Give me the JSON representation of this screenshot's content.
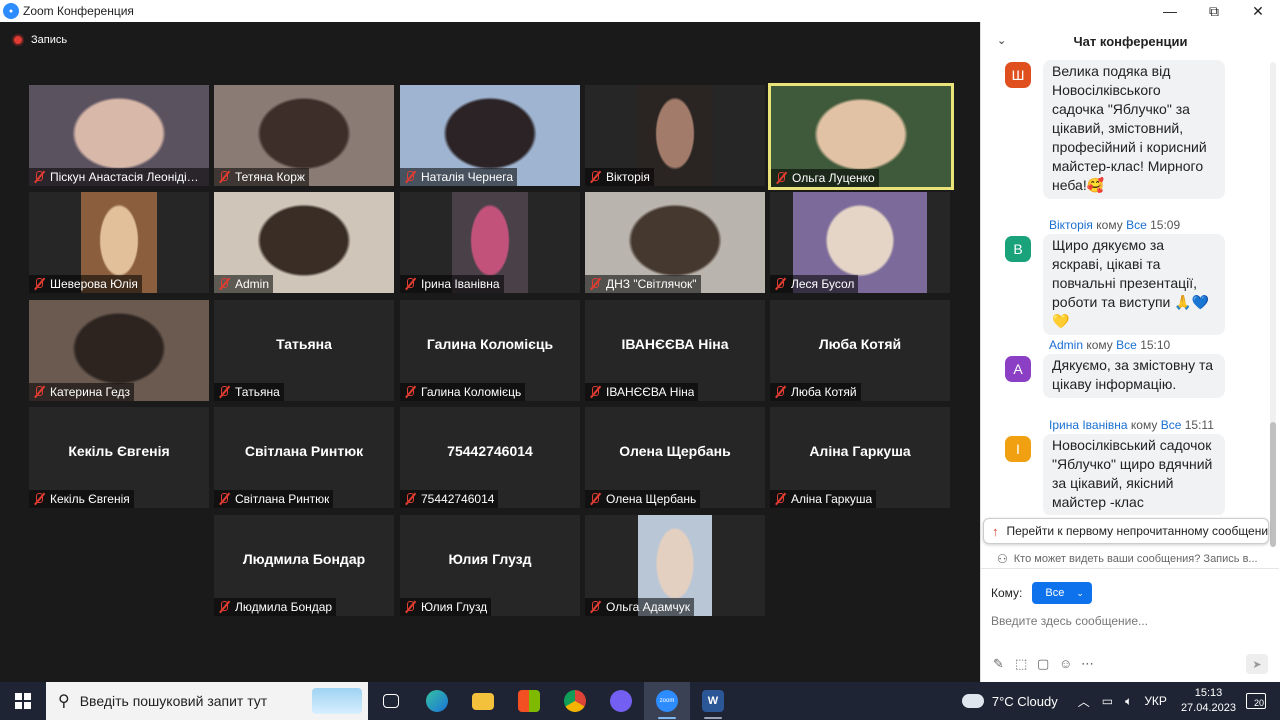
{
  "window": {
    "title": "Zoom Конференция",
    "minimize": "—",
    "maximize": "⧉",
    "close": "✕"
  },
  "recording": {
    "label": "Запись"
  },
  "tiles": [
    {
      "name": "Піскун Анастасія Леонідівна",
      "video": true
    },
    {
      "name": "Тетяна Корж",
      "video": true
    },
    {
      "name": "Наталія Чернега",
      "video": true
    },
    {
      "name": "Вікторія",
      "video": true
    },
    {
      "name": "Ольга Луценко",
      "video": true,
      "active": true
    },
    {
      "name": "Шеверова Юлія",
      "video": true
    },
    {
      "name": "Admin",
      "video": true
    },
    {
      "name": "Ірина Іванівна",
      "video": true
    },
    {
      "name": "ДНЗ \"Світлячок\"",
      "video": true
    },
    {
      "name": "Леся Бусол",
      "video": true
    },
    {
      "name": "Катерина Гедз",
      "video": true
    },
    {
      "name": "Татьяна",
      "center": "Татьяна"
    },
    {
      "name": "Галина Коломієць",
      "center": "Галина  Коломієць"
    },
    {
      "name": "ІВАНЄЄВА Ніна",
      "center": "ІВАНЄЄВА Ніна"
    },
    {
      "name": "Люба Котяй",
      "center": "Люба Котяй"
    },
    {
      "name": "Кекіль Євгенія",
      "center": "Кекіль Євгенія"
    },
    {
      "name": "Світлана Ринтюк",
      "center": "Світлана Ринтюк"
    },
    {
      "name": "75442746014",
      "center": "75442746014"
    },
    {
      "name": "Олена Щербань",
      "center": "Олена Щербань"
    },
    {
      "name": "Аліна Гаркуша",
      "center": "Аліна Гаркуша"
    },
    {
      "name": "Людмила Бондар",
      "center": "Людмила  Бондар"
    },
    {
      "name": "Юлия Глузд",
      "center": "Юлия Глузд"
    },
    {
      "name": "Ольга Адамчук",
      "video": true
    }
  ],
  "chat": {
    "header": "Чат конференции",
    "collapse": "⌄",
    "messages": [
      {
        "avatar_letter": "Ш",
        "avatar_color": "#e0501e",
        "text": "Велика подяка від Новосілківського садочка \"Яблучко\" за цікавий, змістовний, професійний і корисний майстер-клас! Мирного неба!🥰"
      },
      {
        "sender": "Вікторія",
        "to_word": "кому",
        "to": "Все",
        "time": "15:09",
        "avatar_letter": "В",
        "avatar_color": "#1aa37a",
        "text": "Щиро дякуємо за яскраві, цікаві та повчальні презентації, роботи та виступи 🙏💙💛"
      },
      {
        "sender": "Admin",
        "to_word": "кому",
        "to": "Все",
        "time": "15:10",
        "avatar_letter": "A",
        "avatar_color": "#8a3fc4",
        "text": "Дякуємо, за змістовну та цікаву інформацію."
      },
      {
        "sender": "Ірина Іванівна",
        "to_word": "кому",
        "to": "Все",
        "time": "15:11",
        "avatar_letter": "I",
        "avatar_color": "#f0a010",
        "text": "Новосілківський садочок \"Яблучко\" щиро вдячний за цікавий, якісний майстер -клас"
      }
    ],
    "unread_button": "Перейти к первому непрочитанному сообщению",
    "who_can_see": "Кто может видеть ваши сообщения? Запись в...",
    "to_label": "Кому:",
    "to_value": "Все",
    "input_placeholder": "Введите здесь сообщение..."
  },
  "taskbar": {
    "search_placeholder": "Введіть пошуковий запит тут",
    "zoom_label": "zoom",
    "word_label": "W",
    "weather": "7°C  Cloudy",
    "lang": "УКР",
    "time": "15:13",
    "date": "27.04.2023",
    "notifications": "20"
  },
  "colors": {
    "accent": "#0e72ed",
    "active_speaker": "#e9e37a",
    "muted": "#e03c31"
  }
}
